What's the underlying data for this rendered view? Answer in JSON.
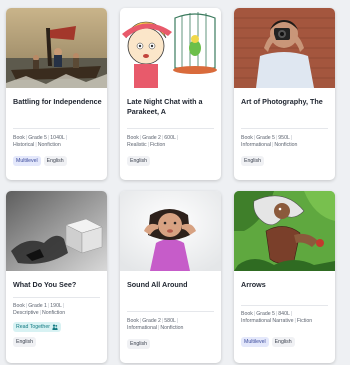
{
  "books": [
    {
      "title": "Battling for Independence",
      "meta_line1": [
        "Book",
        "Grade 5",
        "1040L"
      ],
      "meta_line2": [
        "Historical",
        "Nonfiction"
      ],
      "tags": [
        "Multilevel",
        "English"
      ],
      "cover_icon": "painting-boat-crossing-image"
    },
    {
      "title": "Late Night Chat with a Parakeet, A",
      "meta_line1": [
        "Book",
        "Grade 2",
        "600L"
      ],
      "meta_line2": [
        "Realistic",
        "Fiction"
      ],
      "tags": [
        "English"
      ],
      "cover_icon": "girl-and-parakeet-cage-image"
    },
    {
      "title": "Art of Photography, The",
      "meta_line1": [
        "Book",
        "Grade 5",
        "950L"
      ],
      "meta_line2": [
        "Informational",
        "Nonfiction"
      ],
      "tags": [
        "English"
      ],
      "cover_icon": "photographer-with-camera-image"
    },
    {
      "title": "What Do You See?",
      "meta_line1": [
        "Book",
        "Grade 1",
        "190L"
      ],
      "meta_line2": [
        "Descriptive",
        "Nonfiction"
      ],
      "tags": [
        "Read Together",
        "English"
      ],
      "cover_icon": "cube-shadow-image"
    },
    {
      "title": "Sound All Around",
      "meta_line1": [
        "Book",
        "Grade 2",
        "580L"
      ],
      "meta_line2": [
        "Informational",
        "Nonfiction"
      ],
      "tags": [
        "English"
      ],
      "cover_icon": "child-listening-image"
    },
    {
      "title": "Arrows",
      "meta_line1": [
        "Book",
        "Grade 5",
        "840L"
      ],
      "meta_line2": [
        "Informational Narrative",
        "Fiction"
      ],
      "tags": [
        "Multilevel",
        "English"
      ],
      "cover_icon": "illustrated-character-image"
    }
  ],
  "colors": {
    "multilevel_tag": "#e4e8fb",
    "read_together_tag": "#d8f2f3",
    "card_bg": "#ffffff",
    "page_bg": "#eef0f3"
  }
}
